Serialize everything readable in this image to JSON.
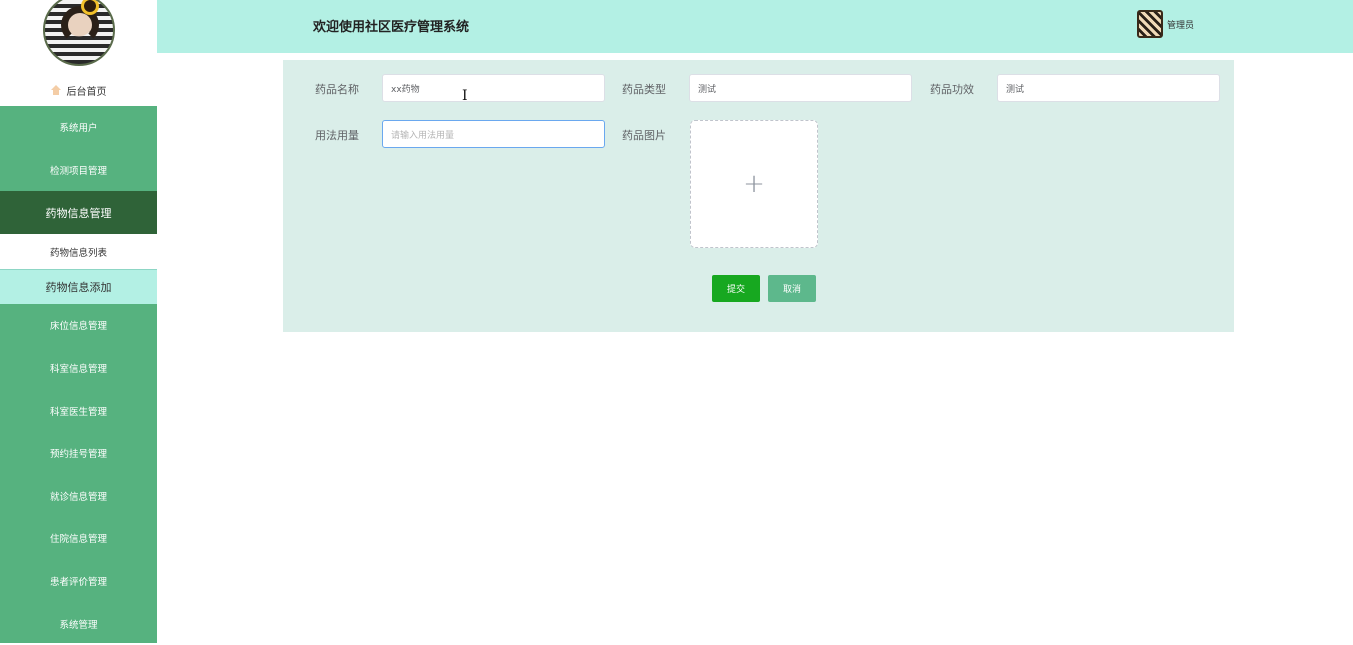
{
  "sidebar": {
    "home": "后台首页",
    "items": [
      "系统用户",
      "检测项目管理"
    ],
    "active": "药物信息管理",
    "sub": [
      "药物信息列表",
      "药物信息添加"
    ],
    "rest": [
      "床位信息管理",
      "科室信息管理",
      "科室医生管理",
      "预约挂号管理",
      "就诊信息管理",
      "住院信息管理",
      "患者评价管理",
      "系统管理"
    ]
  },
  "header": {
    "title": "欢迎使用社区医疗管理系统",
    "user": "管理员"
  },
  "form": {
    "name_label": "药品名称",
    "name_value": "xx药物",
    "type_label": "药品类型",
    "type_value": "测试",
    "effect_label": "药品功效",
    "effect_value": "测试",
    "usage_label": "用法用量",
    "usage_placeholder": "请输入用法用量",
    "image_label": "药品图片",
    "upload_plus": "+",
    "submit": "提交",
    "cancel": "取消"
  },
  "colors": {
    "sidebar": "#56b27f",
    "sidebar_active": "#2f6338",
    "header": "#b3f0e4",
    "panel": "#daeee9",
    "submit": "#17a820"
  }
}
